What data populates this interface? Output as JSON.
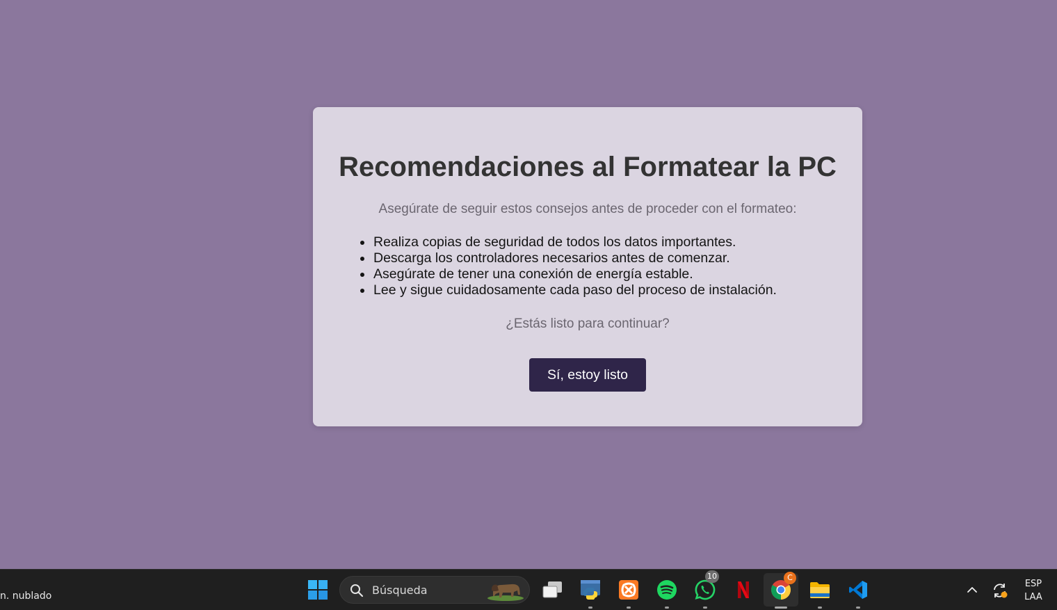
{
  "card": {
    "title": "Recomendaciones al Formatear la PC",
    "subtitle": "Asegúrate de seguir estos consejos antes de proceder con el formateo:",
    "tips": [
      "Realiza copias de seguridad de todos los datos importantes.",
      "Descarga los controladores necesarios antes de comenzar.",
      "Asegúrate de tener una conexión de energía estable.",
      "Lee y sigue cuidadosamente cada paso del proceso de instalación."
    ],
    "question": "¿Estás listo para continuar?",
    "button_label": "Sí, estoy listo"
  },
  "colors": {
    "page_background": "#8b779d",
    "card_background": "#dbd5e1",
    "button_background": "#2f2549",
    "taskbar_background": "#1f1f1f"
  },
  "taskbar": {
    "weather_text": "n. nublado",
    "search_placeholder": "Búsqueda",
    "apps": [
      {
        "name": "start",
        "icon": "windows-logo-icon"
      },
      {
        "name": "task-view",
        "icon": "task-view-icon"
      },
      {
        "name": "python",
        "icon": "python-icon"
      },
      {
        "name": "xampp",
        "icon": "xampp-icon"
      },
      {
        "name": "spotify",
        "icon": "spotify-icon"
      },
      {
        "name": "whatsapp",
        "icon": "whatsapp-icon",
        "badge": "10"
      },
      {
        "name": "netflix",
        "icon": "netflix-icon"
      },
      {
        "name": "chrome",
        "icon": "chrome-icon",
        "badge": "C"
      },
      {
        "name": "file-explorer",
        "icon": "folder-icon"
      },
      {
        "name": "vscode",
        "icon": "vscode-icon"
      }
    ],
    "tray": {
      "language_line1": "ESP",
      "language_line2": "LAA"
    }
  }
}
